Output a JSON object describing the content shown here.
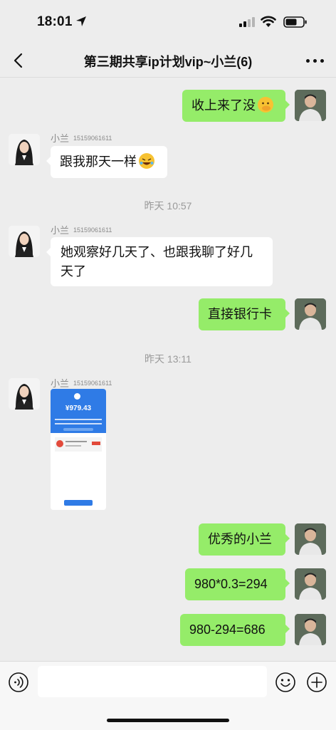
{
  "status_bar": {
    "time": "18:01"
  },
  "header": {
    "title": "第三期共享ip计划vip~小兰(6)"
  },
  "messages": [
    {
      "side": "right",
      "text": "收上来了没",
      "emoji": "face-with-hand-over-mouth"
    },
    {
      "side": "left",
      "sender": "小兰",
      "sender_phone": "15159061611",
      "text": "跟我那天一样",
      "emoji": "rolling-on-floor-laughing"
    },
    {
      "timestamp": "昨天 10:57"
    },
    {
      "side": "left",
      "sender": "小兰",
      "sender_phone": "15159061611",
      "text_line1": "她观察好几天了、也跟我聊了好几",
      "text_line2": "天了"
    },
    {
      "side": "right",
      "text": "直接银行卡"
    },
    {
      "timestamp": "昨天 13:11"
    },
    {
      "side": "left",
      "sender": "小兰",
      "sender_phone": "15159061611",
      "image": {
        "amount": "¥979.43"
      }
    },
    {
      "side": "right",
      "text": "优秀的小兰"
    },
    {
      "side": "right",
      "text": "980*0.3=294"
    },
    {
      "side": "right",
      "text": "980-294=686"
    }
  ],
  "input": {
    "placeholder": ""
  },
  "colors": {
    "bubble_self": "#95ec69",
    "bubble_other": "#ffffff",
    "background": "#ededed"
  },
  "icons": [
    "location-arrow-icon",
    "signal-icon",
    "wifi-icon",
    "battery-icon",
    "back-chevron-icon",
    "more-dots-icon",
    "voice-icon",
    "emoji-icon",
    "plus-icon"
  ]
}
